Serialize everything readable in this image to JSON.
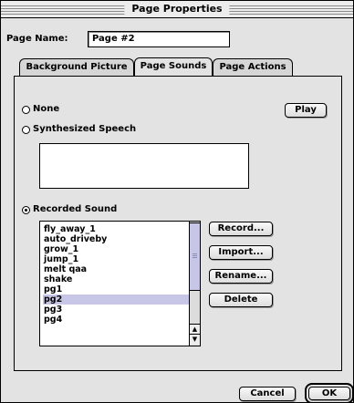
{
  "window": {
    "title": "Page Properties"
  },
  "page_name": {
    "label": "Page Name:",
    "value": "Page #2"
  },
  "tabs": [
    {
      "label": "Background Picture",
      "active": false
    },
    {
      "label": "Page Sounds",
      "active": true
    },
    {
      "label": "Page Actions",
      "active": false
    }
  ],
  "sound": {
    "option_none": "None",
    "option_speech": "Synthesized Speech",
    "option_recorded": "Recorded Sound",
    "selected_option": "Recorded Sound",
    "speech_text": "",
    "play_label": "Play"
  },
  "recorded_list": {
    "items": [
      "fly_away_1",
      "auto_driveby",
      "grow_1",
      "jump_1",
      "melt qaa",
      "shake",
      "pg1",
      "pg2",
      "pg3",
      "pg4"
    ],
    "selected": "pg2"
  },
  "side_buttons": {
    "record": "Record...",
    "import": "Import...",
    "rename": "Rename...",
    "delete": "Delete"
  },
  "footer": {
    "cancel": "Cancel",
    "ok": "OK"
  },
  "colors": {
    "selection": "#c8c6e6",
    "dialog_bg": "#e3e3e3"
  }
}
